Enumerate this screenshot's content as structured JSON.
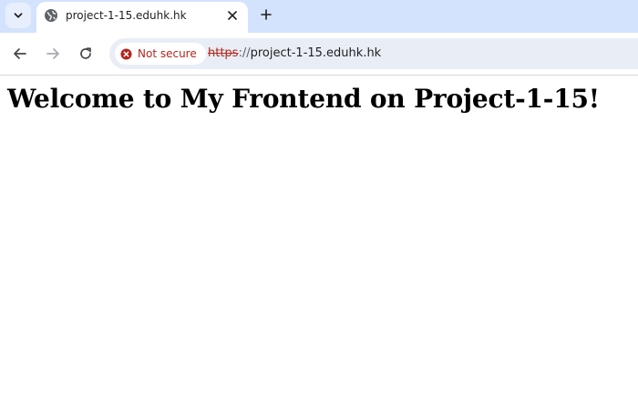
{
  "tab": {
    "title": "project-1-15.eduhk.hk",
    "favicon": "globe-icon"
  },
  "toolbar": {
    "tab_search_icon": "chevron-down-icon",
    "new_tab_icon": "plus-icon",
    "close_icon": "close-icon",
    "back_icon": "arrow-left-icon",
    "forward_icon": "arrow-right-icon",
    "reload_icon": "reload-icon"
  },
  "omnibox": {
    "security_label": "Not secure",
    "security_icon": "error-circle-icon",
    "url_scheme": "https",
    "url_separator": "://",
    "url_host": "project-1-15.eduhk.hk"
  },
  "page": {
    "heading": "Welcome to My Frontend on Project-1-15!"
  },
  "colors": {
    "tabstrip_bg": "#d3e3fd",
    "omnibox_bg": "#e9eef6",
    "warning_red": "#b3261e"
  }
}
